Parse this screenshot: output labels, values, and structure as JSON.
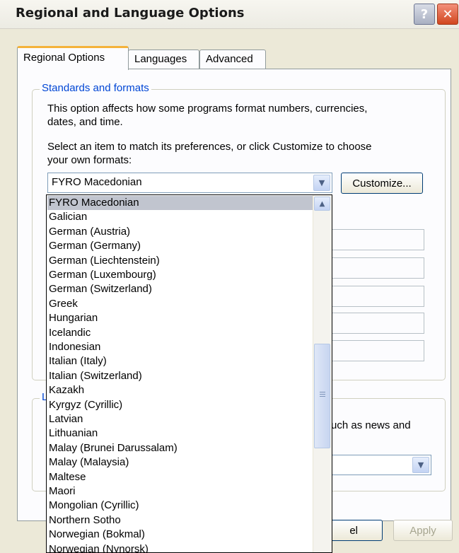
{
  "window": {
    "title": "Regional and Language Options",
    "help_glyph": "?",
    "close_glyph": "✕"
  },
  "tabs": [
    {
      "label": "Regional Options",
      "active": true
    },
    {
      "label": "Languages",
      "active": false
    },
    {
      "label": "Advanced",
      "active": false
    }
  ],
  "standards": {
    "group_title": "Standards and formats",
    "desc_line1": "This option affects how some programs format numbers, currencies,",
    "desc_line2": "dates, and time.",
    "select_line1": "Select an item to match its preferences, or click Customize to choose",
    "select_line2": "your own formats:",
    "selected_format": "FYRO Macedonian",
    "customize_label": "Customize..."
  },
  "location": {
    "group_title_fragment": "L",
    "text_fragment": "uch as news and"
  },
  "buttons": {
    "cancel_fragment": "el",
    "apply_label": "Apply"
  },
  "dropdown": {
    "items": [
      "FYRO Macedonian",
      "Galician",
      "German (Austria)",
      "German (Germany)",
      "German (Liechtenstein)",
      "German (Luxembourg)",
      "German (Switzerland)",
      "Greek",
      "Hungarian",
      "Icelandic",
      "Indonesian",
      "Italian (Italy)",
      "Italian (Switzerland)",
      "Kazakh",
      "Kyrgyz (Cyrillic)",
      "Latvian",
      "Lithuanian",
      "Malay (Brunei Darussalam)",
      "Malay (Malaysia)",
      "Maltese",
      "Maori",
      "Mongolian (Cyrillic)",
      "Northern Sotho",
      "Norwegian (Bokmal)",
      "Norwegian (Nynorsk)"
    ],
    "selected_index": 0
  },
  "colors": {
    "accent_blue": "#0046d5",
    "tab_highlight": "#f4b23a",
    "close_red": "#d1461f"
  }
}
